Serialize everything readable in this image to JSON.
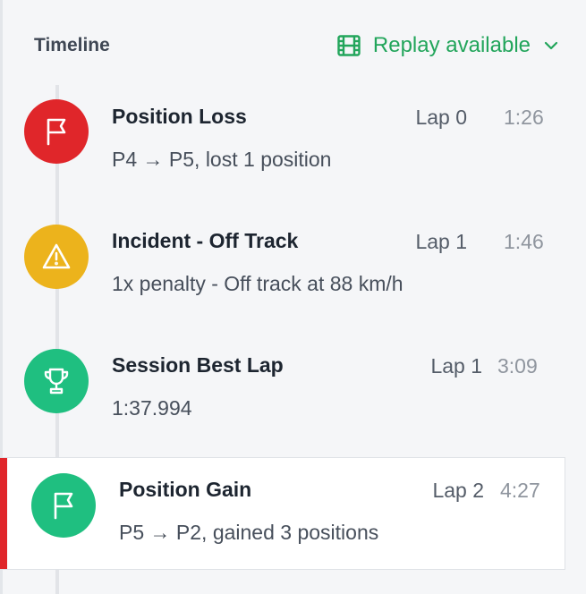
{
  "header": {
    "title": "Timeline",
    "replay_label": "Replay available",
    "accent_color": "#22a55b"
  },
  "events": [
    {
      "title": "Position Loss",
      "lap": "Lap 0",
      "time": "1:26",
      "detail": "P4 → P5, lost 1 position",
      "icon": "flag-icon",
      "color": "#e0262a"
    },
    {
      "title": "Incident - Off Track",
      "lap": "Lap 1",
      "time": "1:46",
      "detail": "1x penalty - Off track at 88 km/h",
      "icon": "warning-icon",
      "color": "#ecb31c"
    },
    {
      "title": "Session Best Lap",
      "lap": "Lap 1",
      "time": "3:09",
      "detail": "1:37.994",
      "icon": "trophy-icon",
      "color": "#1fbf80"
    },
    {
      "title": "Position Gain",
      "lap": "Lap 2",
      "time": "4:27",
      "detail": "P5 → P2, gained 3 positions",
      "icon": "flag-icon",
      "color": "#1fbf80",
      "selected": true
    }
  ]
}
